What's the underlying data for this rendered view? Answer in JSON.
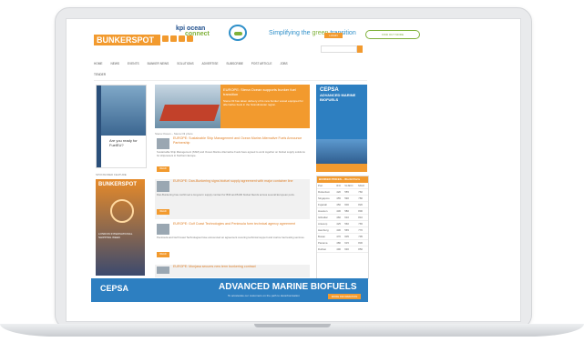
{
  "header": {
    "logo_line1": "kpi ocean",
    "logo_line2": "connect",
    "tagline_a": "Simplifying the ",
    "tagline_green": "green",
    "tagline_b": " transition",
    "cta": "FIND OUT MORE",
    "brand": "BUNKERSPOT",
    "login": "LOGIN",
    "search_placeholder": "Search..."
  },
  "nav": {
    "items": [
      "HOME",
      "NEWS",
      "EVENTS",
      "BUNKER NEWS",
      "SOLUTIONS",
      "ADVERTISE",
      "SUBSCRIBE",
      "POST ARTICLE",
      "JOBS"
    ],
    "second_row": "TENDER"
  },
  "hero": {
    "title": "EUROPE: Stena Ocean supports bunker fuel transition",
    "text": "Stena Oil has taken delivery of its new bunker vessel equipped for alternative fuels in the Scandinavian region.",
    "caption": "Stena Ocean – Stena Oil photo"
  },
  "ads": {
    "left_top_text": "Are you ready for FuelEU?",
    "cepsa_brand": "CEPSA",
    "cepsa_headline": "ADVANCED MARINE BIOFUELS",
    "sponsored_label": "SPONSORED FEATURE",
    "left_bottom_brand": "BUNKERSPOT",
    "left_bottom_text": "LONDON INTERNATIONAL SHIPPING WEEK",
    "banner_brand": "CEPSA",
    "banner_headline": "ADVANCED MARINE BIOFUELS",
    "banner_sub": "To accelerate our customers on the path to decarbonisation",
    "banner_button": "MORE INFORMATION"
  },
  "articles": [
    {
      "title": "EUROPE: Sustainable Ship Management and Ocean Marine Alternative Fuels Announce Partnership",
      "text": "Sustainable Ship Management (SSM) and Ocean Marine Alternative Fuels have agreed to work together on biofuel supply solutions for shipowners in Northern Europe.",
      "more": "READ MORE"
    },
    {
      "title": "EUROPE: Dan-Bunkering signs biofuel supply agreement with major container line",
      "text": "Dan-Bunkering has confirmed a long-term supply contract for B30 and B100 biofuel blends across several European ports.",
      "more": "READ MORE"
    },
    {
      "title": "EUROPE: Gulf Coast Technologies and Peninsula form technical agency agreement",
      "text": "Peninsula and Gulf Coast Technologies have announced an agreement covering technical support and marine fuel testing services.",
      "more": "READ MORE"
    },
    {
      "title": "EUROPE: Monjasa secures new term bunkering contract",
      "text": "",
      "more": "READ MORE"
    }
  ],
  "prices": {
    "title": "BUNKER PRICES – World Ports",
    "columns": [
      "Port",
      "IFO",
      "VLSFO",
      "MGO"
    ],
    "rows": [
      [
        "Rotterdam",
        "420",
        "555",
        "760"
      ],
      [
        "Singapore",
        "455",
        "590",
        "780"
      ],
      [
        "Fujairah",
        "450",
        "600",
        "820"
      ],
      [
        "Houston",
        "430",
        "580",
        "800"
      ],
      [
        "Gibraltar",
        "460",
        "610",
        "810"
      ],
      [
        "Antwerp",
        "425",
        "560",
        "765"
      ],
      [
        "Hamburg",
        "430",
        "565",
        "770"
      ],
      [
        "Busan",
        "470",
        "605",
        "795"
      ],
      [
        "Panama",
        "480",
        "615",
        "830"
      ],
      [
        "Durban",
        "490",
        "630",
        "850"
      ]
    ]
  },
  "colors": {
    "accent": "#f29a2e",
    "blue": "#2d7fc1",
    "green": "#7fb13a"
  }
}
